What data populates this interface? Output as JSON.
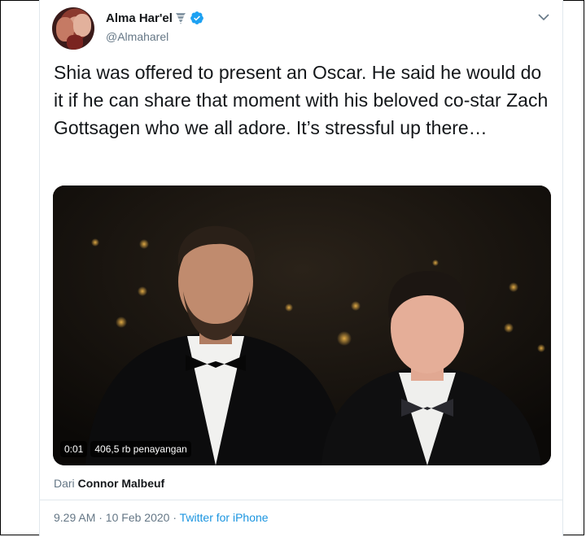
{
  "author": {
    "name": "Alma Har'el",
    "handle": "@Almaharel",
    "verified_color": "#1da1f2"
  },
  "tweet": {
    "text": "Shia was offered to present an Oscar. He said he would do it if he can share that moment with his beloved co-star Zach Gottsagen who we all adore. It’s stressful up there…"
  },
  "video": {
    "time": "0:01",
    "views": "406,5 rb penayangan"
  },
  "attribution": {
    "prefix": "Dari",
    "author": "Connor Malbeuf"
  },
  "meta": {
    "time": "9.29 AM · 10 Feb 2020",
    "separator": " · ",
    "source": "Twitter for iPhone"
  },
  "colors": {
    "link": "#1b95e0",
    "secondary_text": "#657786",
    "primary_text": "#14171a"
  },
  "icons": [
    "verified-badge-icon",
    "tornado-emoji-icon",
    "chevron-down-icon"
  ]
}
